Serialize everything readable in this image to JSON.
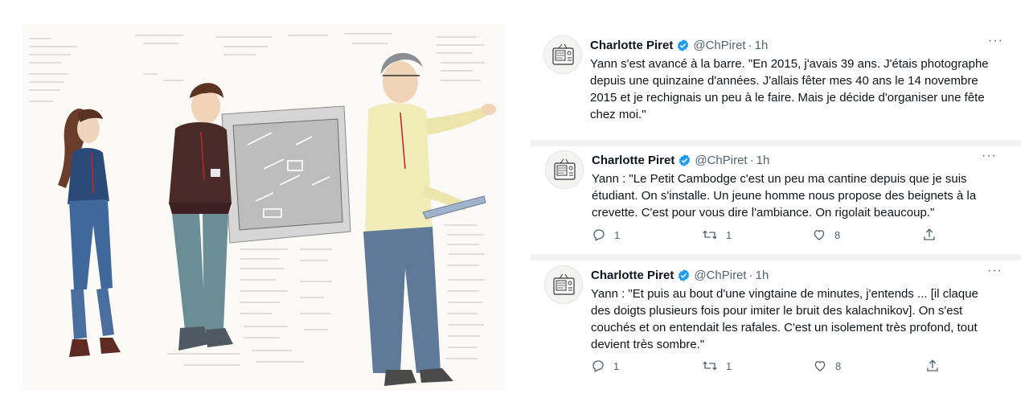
{
  "tweets": [
    {
      "author": "Charlotte Piret",
      "handle": "@ChPiret",
      "dot": "·",
      "time": "1h",
      "more": "···",
      "text": "Yann s'est avancé à la barre. \"En 2015, j'avais 39 ans. J'étais photographe\ndepuis une quinzaine d'années. J'allais fêter mes 40 ans le 14 novembre\n2015 et je rechignais un peu à le faire. Mais je décide d'organiser une fête\nchez moi.\""
    },
    {
      "author": "Charlotte Piret",
      "handle": "@ChPiret",
      "dot": "·",
      "time": "1h",
      "more": "···",
      "text": "Yann : \"Le Petit Cambodge c'est un peu ma cantine depuis que je suis\nétudiant. On s'installe. Un jeune homme nous propose des beignets à la\ncrevette. C'est pour vous dire l'ambiance. On rigolait beaucoup.\"",
      "replies": "1",
      "retweets": "1",
      "likes": "8"
    },
    {
      "author": "Charlotte Piret",
      "handle": "@ChPiret",
      "dot": "·",
      "time": "1h",
      "more": "···",
      "text": "Yann : \"Et puis au bout d'une vingtaine de minutes, j'entends ... [il claque\ndes doigts plusieurs fois pour imiter le bruit des kalachnikov]. On s'est\ncouchés et on entendait les rafales. C'est un isolement très profond, tout\ndevient très sombre.\"",
      "replies": "1",
      "retweets": "1",
      "likes": "8"
    }
  ],
  "icons": {
    "verified": "verified-badge-icon",
    "reply": "reply-icon",
    "retweet": "retweet-icon",
    "like": "like-icon",
    "share": "share-icon",
    "more": "more-icon"
  },
  "colors": {
    "verified": "#1d9bf0",
    "secondary_text": "#536471",
    "primary_text": "#0f1419"
  }
}
